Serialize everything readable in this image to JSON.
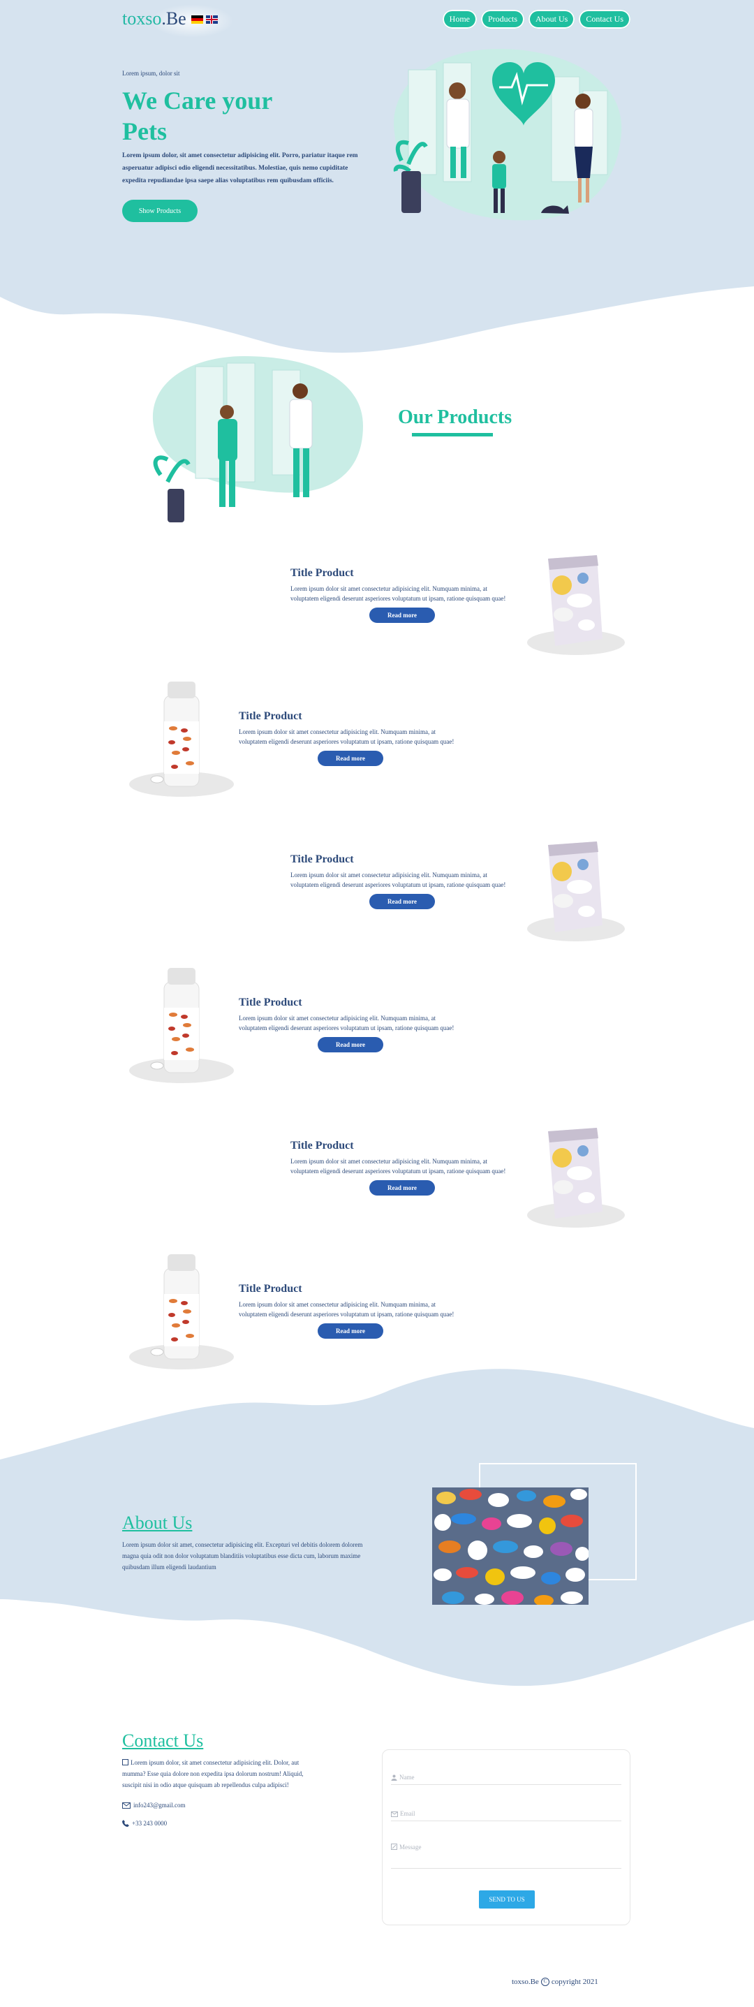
{
  "brand": {
    "name": "toxso",
    "suffix": ".Be"
  },
  "nav": {
    "items": [
      "Home",
      "Products",
      "About Us",
      "Contact Us"
    ]
  },
  "hero": {
    "kicker": "Lorem ipsum, dolor sit",
    "title": "We Care your Pets",
    "text": "Lorem ipsum dolor, sit amet consectetur adipisicing elit. Porro, pariatur itaque rem asperuatur adipisci odio eligendi necessitatibus. Molestiae, quis nemo cupiditate expedita repudiandae ipsa saepe alias voluptatibus rem quibusdam officiis.",
    "button": "Show Products"
  },
  "products": {
    "heading": "Our Products",
    "items": [
      {
        "title": "Title Product",
        "desc": "Lorem ipsum dolor sit amet consectetur adipisicing elit. Numquam minima, at voluptatem eligendi deserunt asperiores voluptatum ut ipsam, ratione quisquam quae!",
        "button": "Read more",
        "image": "bag-icon"
      },
      {
        "title": "Title Product",
        "desc": "Lorem ipsum dolor sit amet consectetur adipisicing elit. Numquam minima, at voluptatem eligendi deserunt asperiores voluptatum ut ipsam, ratione quisquam quae!",
        "button": "Read more",
        "image": "bottle-icon"
      },
      {
        "title": "Title Product",
        "desc": "Lorem ipsum dolor sit amet consectetur adipisicing elit. Numquam minima, at voluptatem eligendi deserunt asperiores voluptatum ut ipsam, ratione quisquam quae!",
        "button": "Read more",
        "image": "bag-icon"
      },
      {
        "title": "Title Product",
        "desc": "Lorem ipsum dolor sit amet consectetur adipisicing elit. Numquam minima, at voluptatem eligendi deserunt asperiores voluptatum ut ipsam, ratione quisquam quae!",
        "button": "Read more",
        "image": "bottle-icon"
      },
      {
        "title": "Title Product",
        "desc": "Lorem ipsum dolor sit amet consectetur adipisicing elit. Numquam minima, at voluptatem eligendi deserunt asperiores voluptatum ut ipsam, ratione quisquam quae!",
        "button": "Read more",
        "image": "bag-icon"
      },
      {
        "title": "Title Product",
        "desc": "Lorem ipsum dolor sit amet consectetur adipisicing elit. Numquam minima, at voluptatem eligendi deserunt asperiores voluptatum ut ipsam, ratione quisquam quae!",
        "button": "Read more",
        "image": "bottle-icon"
      }
    ]
  },
  "about": {
    "title": "About Us",
    "text": "Lorem ipsum dolor sit amet, consectetur adipisicing elit. Excepturi vel debitis dolorem dolorem magna quia odit non dolor voluptatum blanditiis voluptatibus esse dicta cum, laborum maxime quibusdam illum eligendi laudantium"
  },
  "contact": {
    "title": "Contact Us",
    "text": "Lorem ipsum dolor, sit amet consectetur adipisicing elit. Dolor, aut mumma? Esse quia dolore non expedita ipsa dolorum nostrum! Aliquid, suscipit nisi in odio atque quisquam ab repellendus culpa adipisci!",
    "email": "info243@gmail.com",
    "phone": "+33 243 0000",
    "form": {
      "name_placeholder": "Name",
      "email_placeholder": "Email",
      "message_placeholder": "Message",
      "submit": "SEND TO US"
    }
  },
  "footer": {
    "brand": "toxso.Be",
    "copyright": "copyright 2021"
  },
  "colors": {
    "teal": "#1fbf9f",
    "navy": "#2d4a7a",
    "button_blue": "#2a5cb0",
    "band": "#d6e3ef",
    "submit": "#2da8e6"
  }
}
